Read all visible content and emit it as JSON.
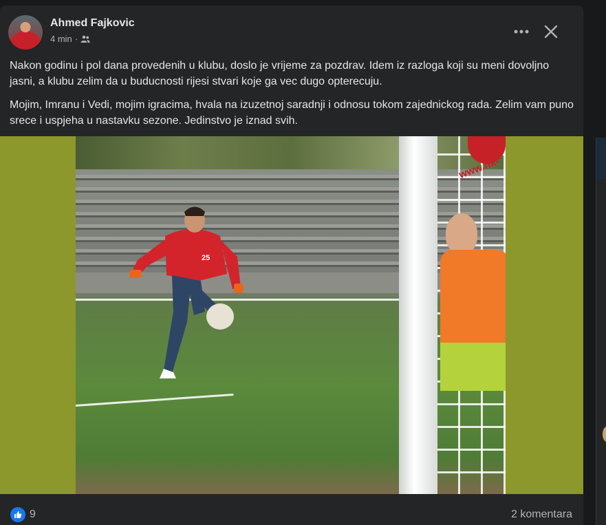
{
  "post": {
    "author": "Ahmed Fajkovic",
    "time": "4 min",
    "separator": "·",
    "audience_icon": "friends-icon",
    "more_icon": "more-horizontal-icon",
    "close_icon": "close-icon",
    "paragraphs": [
      "Nakon godinu i pol dana provedenih u klubu, doslo je vrijeme za pozdrav. Idem iz razloga koji su meni dovoljno jasni, a klubu zelim da u buducnosti rijesi stvari koje ga vec dugo opterecuju.",
      "Mojim, Imranu i Vedi, mojim igracima, hvala na izuzetnoj saradnji i odnosu tokom zajednickog rada. Zelim vam puno srece i uspjeha u nastavku sezone. Jedinstvo je iznad svih."
    ],
    "image_overlay_text": "www.nk-",
    "player_number": "25"
  },
  "footer": {
    "reaction_icon": "like-icon",
    "reaction_count": "9",
    "comments": "2 komentara"
  },
  "colors": {
    "background": "#18191a",
    "card": "#242526",
    "text_primary": "#e4e6eb",
    "text_secondary": "#b0b3b8",
    "like_blue": "#1877f2",
    "media_matte": "#8c972c"
  }
}
